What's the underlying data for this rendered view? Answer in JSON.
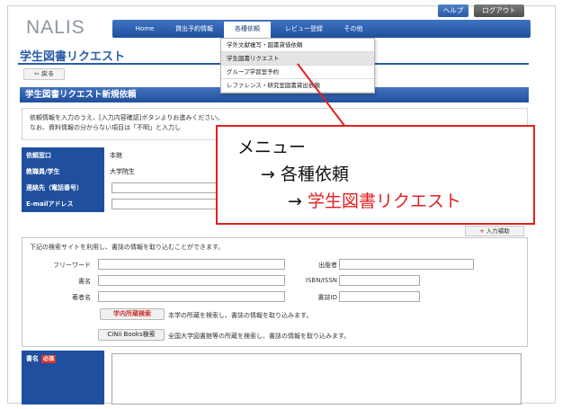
{
  "app": {
    "logo": "NALIS"
  },
  "top_buttons": {
    "help": "ヘルプ",
    "logout": "ログアウト"
  },
  "nav": {
    "items": [
      "Home",
      "貸出予約情報",
      "各種依頼",
      "レビュー登録",
      "その他"
    ],
    "active_index": 2
  },
  "dropdown": {
    "items": [
      "学外文献複写・図書貸借依頼",
      "学生図書リクエスト",
      "グループ学習室予約",
      "レファレンス・研究室図書貸出依頼"
    ],
    "highlight_index": 1
  },
  "page": {
    "title": "学生図書リクエスト",
    "back": "戻る",
    "section_title": "学生図書リクエスト新規依頼",
    "info_line1": "依頼情報を入力のうえ、[入力内容確認]ボタンよりお進みください。",
    "info_line2": "なお、資料情報の分からない項目は「不明」と入力し"
  },
  "form": {
    "rows": [
      {
        "label": "依頼窓口",
        "value": "本館"
      },
      {
        "label": "教職員/学生",
        "value": "大学院生"
      },
      {
        "label": "連絡先（電話番号）",
        "value": ""
      },
      {
        "label": "E-mailアドレス",
        "value": ""
      }
    ]
  },
  "aux_button": "入力補助",
  "search": {
    "description": "下記の検索サイトを利用し、書誌の情報を取り込むことができます。",
    "labels": {
      "freeword": "フリーワード",
      "title": "書名",
      "author": "著者名",
      "publisher": "出版者",
      "isbn": "ISBN/ISSN",
      "bookid": "書誌ID"
    },
    "local_button": "学内所蔵検索",
    "local_note": "本学の所蔵を検索し、書誌の情報を取り込みます。",
    "cinii_button": "CiNii Books検索",
    "cinii_note": "全国大学図書館等の所蔵を検索し、書誌の情報を取り込みます。"
  },
  "title_field": {
    "label": "書名",
    "required": "必須"
  },
  "annotation": {
    "line1": "メニュー",
    "line2_arrow": "→",
    "line2_text": "各種依頼",
    "line3_arrow": "→",
    "line3_text": "学生図書リクエスト"
  },
  "colors": {
    "nav_blue": "#1f4f9d",
    "title_blue": "#2a5da8",
    "annotation_red": "#e02020"
  }
}
